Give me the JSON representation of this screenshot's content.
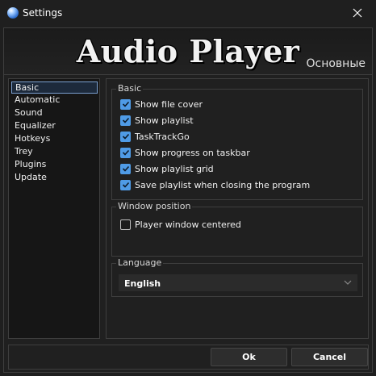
{
  "window": {
    "title": "Settings"
  },
  "banner": {
    "title": "Audio Player",
    "subtitle": "Основные"
  },
  "sidebar": {
    "items": [
      {
        "label": "Basic",
        "active": true
      },
      {
        "label": "Automatic"
      },
      {
        "label": "Sound"
      },
      {
        "label": "Equalizer"
      },
      {
        "label": "Hotkeys"
      },
      {
        "label": "Trey"
      },
      {
        "label": "Plugins"
      },
      {
        "label": "Update"
      }
    ]
  },
  "basic": {
    "title": "Basic",
    "options": [
      {
        "label": "Show file cover",
        "checked": true
      },
      {
        "label": "Show playlist",
        "checked": true
      },
      {
        "label": "TaskTrackGo",
        "checked": true
      },
      {
        "label": "Show progress on taskbar",
        "checked": true
      },
      {
        "label": "Show playlist grid",
        "checked": true
      },
      {
        "label": "Save playlist when closing the program",
        "checked": true
      }
    ]
  },
  "window_position": {
    "title": "Window position",
    "options": [
      {
        "label": "Player window centered",
        "checked": false
      }
    ]
  },
  "language": {
    "title": "Language",
    "selected": "English"
  },
  "buttons": {
    "ok": "Ok",
    "cancel": "Cancel"
  },
  "colors": {
    "accent": "#4f9be6",
    "background": "#202020",
    "border": "#3e3e3e",
    "selection_border": "#7a9fd0"
  },
  "icons": {
    "app": "app-logo-icon",
    "close": "close-icon",
    "check": "checkmark-icon",
    "dropdown": "chevron-down-icon"
  }
}
